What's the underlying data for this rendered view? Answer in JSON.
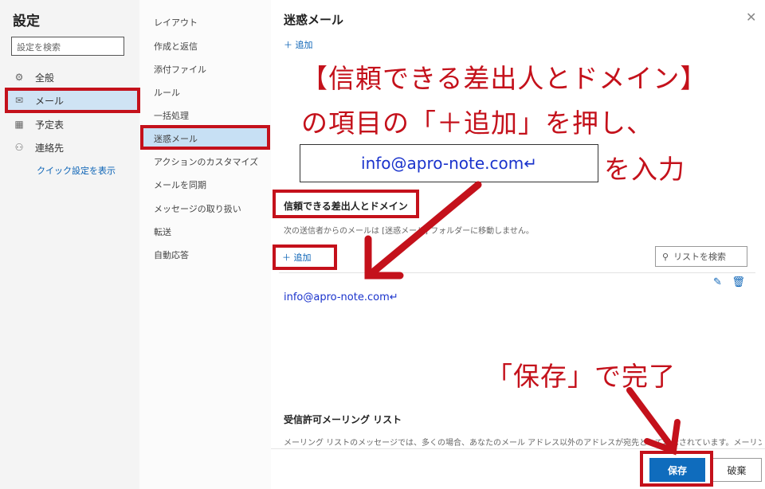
{
  "settings": {
    "title": "設定",
    "search_placeholder": "設定を検索",
    "nav": [
      {
        "label": "全般",
        "icon": "gear-icon"
      },
      {
        "label": "メール",
        "icon": "mail-icon"
      },
      {
        "label": "予定表",
        "icon": "calendar-icon"
      },
      {
        "label": "連絡先",
        "icon": "people-icon"
      }
    ],
    "quick_settings_link": "クイック設定を表示"
  },
  "categories": [
    "レイアウト",
    "作成と返信",
    "添付ファイル",
    "ルール",
    "一括処理",
    "迷惑メール",
    "アクションのカスタマイズ",
    "メールを同期",
    "メッセージの取り扱い",
    "転送",
    "自動応答"
  ],
  "selected_category": "迷惑メール",
  "panel": {
    "title": "迷惑メール",
    "close_icon": "close-icon",
    "top_add": "＋ 追加",
    "trusted_section": {
      "title": "信頼できる差出人とドメイン",
      "description": "次の送信者からのメールは [迷惑メール] フォルダーに移動しません。",
      "add_button": "＋ 追加",
      "search_list_placeholder": "リストを検索",
      "entries": [
        "info@apro-note.com↵"
      ]
    },
    "mailing_section": {
      "title": "受信許可メーリング リスト",
      "description": "メーリング リストのメッセージでは、多くの場合、あなたのメール アドレス以外のアドレスが宛先として表示されています。メーリング リストか"
    },
    "save_button": "保存",
    "discard_button": "破棄"
  },
  "annotations": {
    "line1": "【信頼できる差出人とドメイン】",
    "line2": "の項目の「＋追加」を押し、",
    "email_box": "info@apro-note.com↵",
    "line3": "を入力",
    "save_note": "「保存」で完了"
  },
  "colors": {
    "annotation_red": "#c4111b",
    "accent_blue": "#0f6cbd",
    "selection_blue": "#c7e0f4"
  }
}
